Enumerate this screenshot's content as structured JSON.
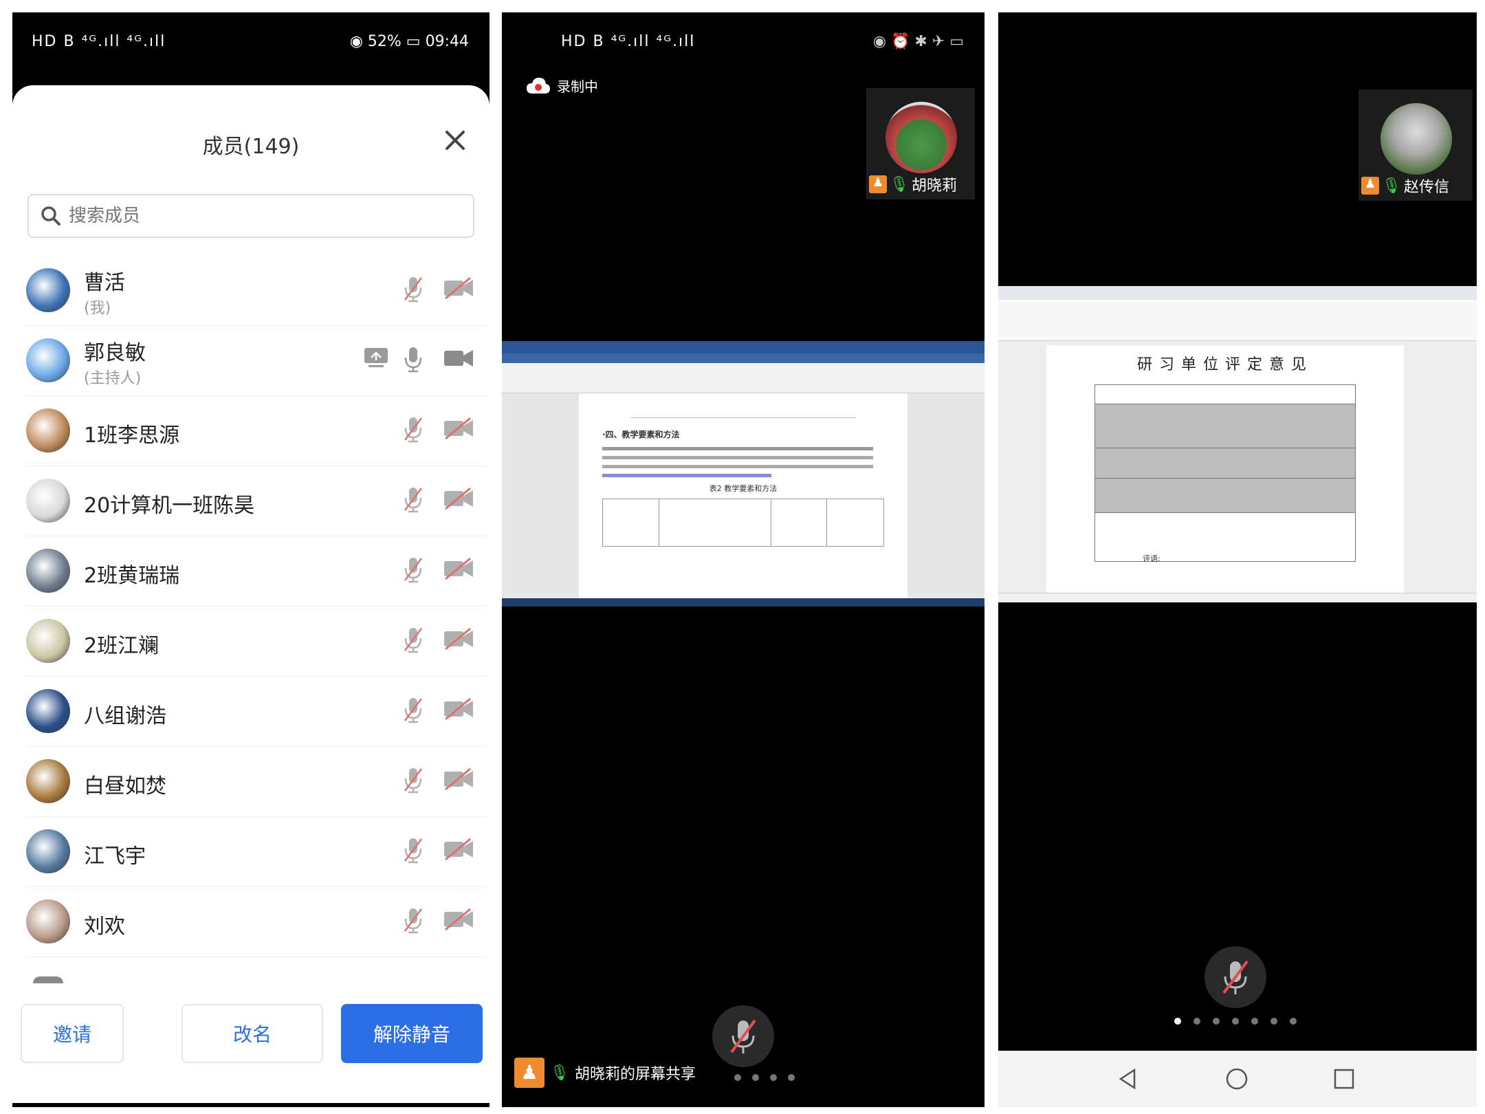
{
  "status_left": {
    "network": "HD B ⁴ᴳ.ıll ⁴ᴳ.ıll"
  },
  "status_right": {
    "battery": "52%",
    "time": "09:44"
  },
  "members_sheet": {
    "title": "成员(149)",
    "search_placeholder": "搜索成员",
    "members": [
      {
        "name": "曹活",
        "role": "(我)",
        "color": "#3d74b8"
      },
      {
        "name": "郭良敏",
        "role": "(主持人)",
        "color": "#6aa8e8"
      },
      {
        "name": "1班李思源",
        "role": "",
        "color": "#c08a5a"
      },
      {
        "name": "20计算机一班陈昊",
        "role": "",
        "color": "#d8d8d8"
      },
      {
        "name": "2班黄瑞瑞",
        "role": "",
        "color": "#6f7f8f"
      },
      {
        "name": "2班江斓",
        "role": "",
        "color": "#cbc6a4"
      },
      {
        "name": "八组谢浩",
        "role": "",
        "color": "#2b4f8a"
      },
      {
        "name": "白昼如焚",
        "role": "",
        "color": "#a97a3d"
      },
      {
        "name": "江飞宇",
        "role": "",
        "color": "#557aa0"
      },
      {
        "name": "刘欢",
        "role": "",
        "color": "#b89a8a"
      }
    ],
    "buttons": {
      "invite": "邀请",
      "rename": "改名",
      "unmute": "解除静音"
    }
  },
  "meeting_view_1": {
    "recording_label": "录制中",
    "thumb_name": "胡晓莉",
    "sharing_label": "胡晓莉的屏幕共享",
    "doc_heading": "·四、教学要素和方法",
    "doc_caption": "表2 教学要素和方法"
  },
  "meeting_view_2": {
    "thumb_name": "赵传信",
    "doc_heading": "研习单位评定意见",
    "doc_footer": "评语:"
  },
  "colors": {
    "accent": "#2a6fe6",
    "muted_red": "#e05050",
    "icon_gray": "#9a9a9a"
  }
}
